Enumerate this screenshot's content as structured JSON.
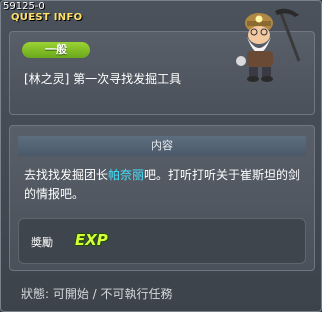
{
  "window": {
    "quest_id": "59125-0",
    "title": "QUEST INFO"
  },
  "quest": {
    "category_badge": "一般",
    "name": "[林之灵] 第一次寻找发掘工具"
  },
  "content": {
    "header": "内容",
    "description_before": "去找找发掘团长",
    "description_highlight": "帕奈丽",
    "description_after": "吧。打听打听关于崔斯坦的剑的情报吧。"
  },
  "reward": {
    "label": "奬勵",
    "exp_label": "EXP"
  },
  "status": {
    "text": "狀態: 可開始 / 不可執行任務"
  },
  "colors": {
    "title": "#ffe067",
    "badge": "#7fbf24",
    "highlight": "#46e3ff",
    "exp": "#d6ff3a"
  }
}
